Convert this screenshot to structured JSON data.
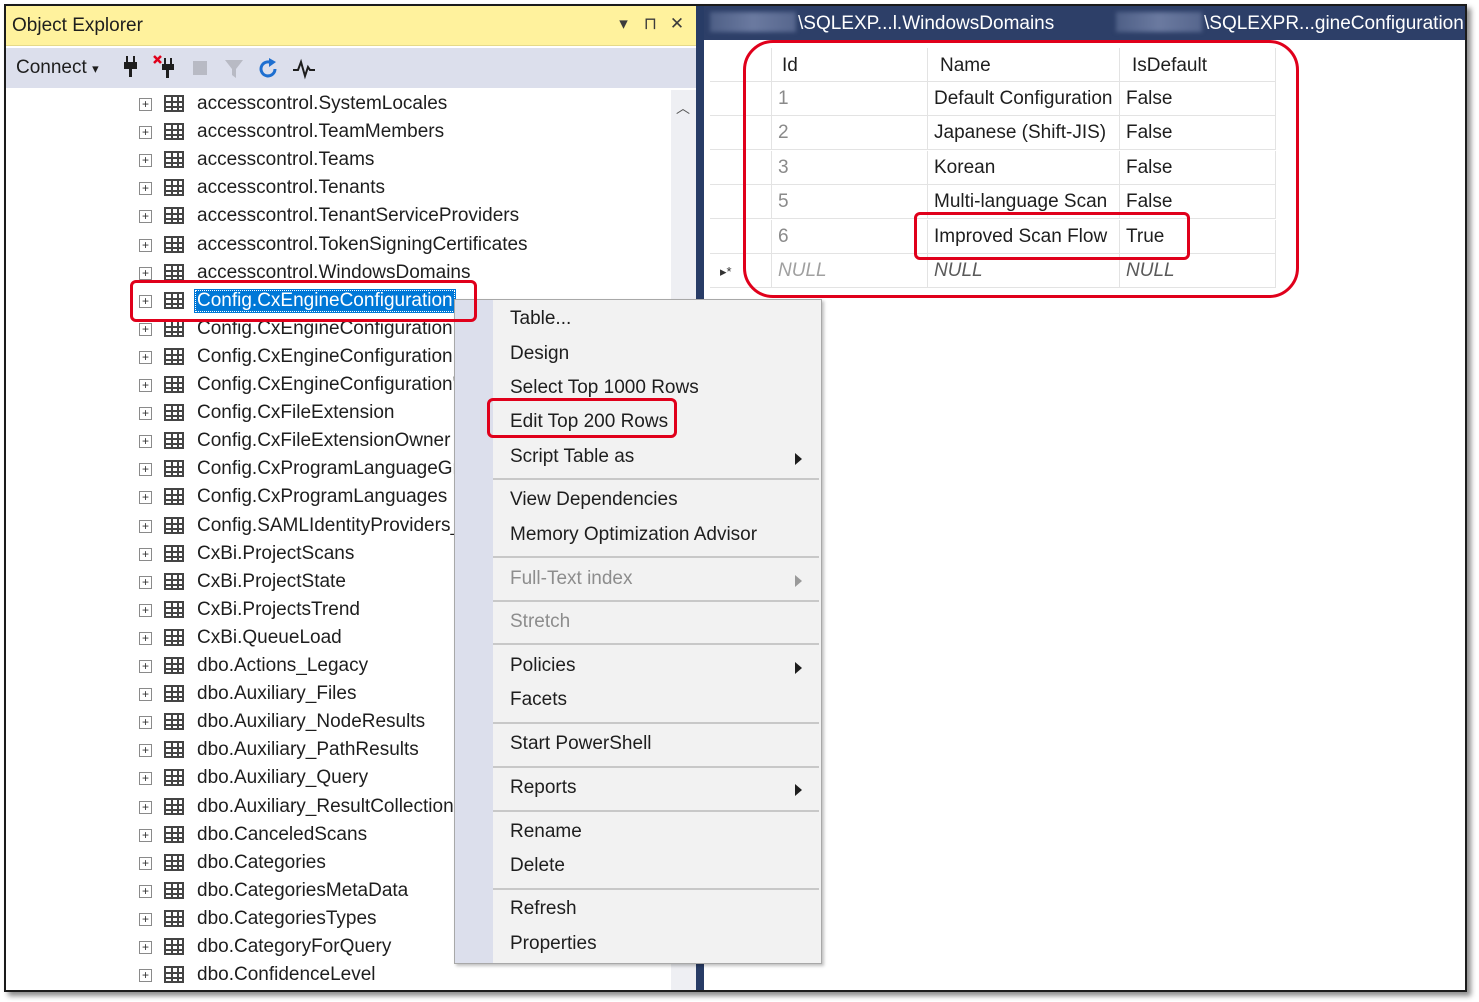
{
  "object_explorer": {
    "title": "Object Explorer",
    "title_buttons": [
      "▾",
      "⊓",
      "✕"
    ],
    "toolbar": {
      "connect_label": "Connect",
      "connect_caret": "▾",
      "icons": [
        "connect-plug-icon",
        "disconnect-icon",
        "stop-icon",
        "filter-icon",
        "refresh-icon",
        "activity-monitor-icon"
      ]
    },
    "tree_items": [
      "accesscontrol.SystemLocales",
      "accesscontrol.TeamMembers",
      "accesscontrol.Teams",
      "accesscontrol.Tenants",
      "accesscontrol.TenantServiceProviders",
      "accesscontrol.TokenSigningCertificates",
      "accesscontrol.WindowsDomains",
      "Config.CxEngineConfiguration",
      "Config.CxEngineConfiguration",
      "Config.CxEngineConfiguration",
      "Config.CxEngineConfiguration'",
      "Config.CxFileExtension",
      "Config.CxFileExtensionOwner",
      "Config.CxProgramLanguageGr",
      "Config.CxProgramLanguages",
      "Config.SAMLIdentityProviders_",
      "CxBi.ProjectScans",
      "CxBi.ProjectState",
      "CxBi.ProjectsTrend",
      "CxBi.QueueLoad",
      "dbo.Actions_Legacy",
      "dbo.Auxiliary_Files",
      "dbo.Auxiliary_NodeResults",
      "dbo.Auxiliary_PathResults",
      "dbo.Auxiliary_Query",
      "dbo.Auxiliary_ResultCollection",
      "dbo.CanceledScans",
      "dbo.Categories",
      "dbo.CategoriesMetaData",
      "dbo.CategoriesTypes",
      "dbo.CategoryForQuery",
      "dbo.ConfidenceLevel"
    ],
    "selected_index": 7
  },
  "editor": {
    "tabs": [
      "\\SQLEXP...l.WindowsDomains",
      "\\SQLEXPR...gineConfiguration"
    ],
    "grid": {
      "columns": [
        "Id",
        "Name",
        "IsDefault"
      ],
      "rows": [
        [
          "1",
          "Default Configuration",
          "False"
        ],
        [
          "2",
          "Japanese (Shift-JIS)",
          "False"
        ],
        [
          "3",
          "Korean",
          "False"
        ],
        [
          "5",
          "Multi-language Scan",
          "False"
        ],
        [
          "6",
          "Improved Scan Flow",
          "True"
        ]
      ],
      "new_row": [
        "NULL",
        "NULL",
        "NULL"
      ],
      "new_row_marker": "▸*"
    }
  },
  "context_menu": {
    "items": [
      {
        "label": "Table...",
        "enabled": true
      },
      {
        "label": "Design",
        "enabled": true
      },
      {
        "label": "Select Top 1000 Rows",
        "enabled": true
      },
      {
        "label": "Edit Top 200 Rows",
        "enabled": true
      },
      {
        "label": "Script Table as",
        "enabled": true,
        "submenu": true
      },
      {
        "label": "View Dependencies",
        "enabled": true
      },
      {
        "label": "Memory Optimization Advisor",
        "enabled": true
      },
      {
        "label": "Full-Text index",
        "enabled": false,
        "submenu": true
      },
      {
        "label": "Stretch",
        "enabled": false
      },
      {
        "label": "Policies",
        "enabled": true,
        "submenu": true
      },
      {
        "label": "Facets",
        "enabled": true
      },
      {
        "label": "Start PowerShell",
        "enabled": true
      },
      {
        "label": "Reports",
        "enabled": true,
        "submenu": true
      },
      {
        "label": "Rename",
        "enabled": true
      },
      {
        "label": "Delete",
        "enabled": true
      },
      {
        "label": "Refresh",
        "enabled": true
      },
      {
        "label": "Properties",
        "enabled": true
      }
    ]
  },
  "colors": {
    "highlight_box": "#e0001b",
    "selection": "#0078d7",
    "tab_strip": "#2d3f68",
    "oe_title": "#fff29d"
  }
}
